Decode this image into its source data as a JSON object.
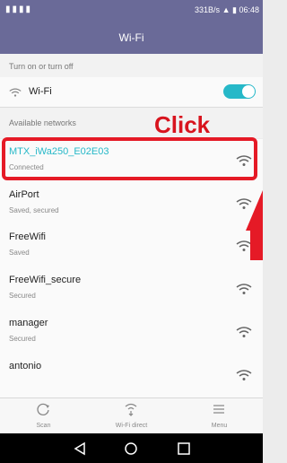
{
  "status": {
    "icons_left": "▮▮▮▮",
    "net_speed": "331B/s",
    "time": "06:48"
  },
  "titlebar": {
    "title": "Wi-Fi"
  },
  "sections": {
    "toggle_header": "Turn on or turn off",
    "available_header": "Available networks"
  },
  "wifi_toggle": {
    "label": "Wi-Fi",
    "state": "on"
  },
  "annotation": {
    "click_text": "Click",
    "highlight_color": "#e51a26"
  },
  "networks": [
    {
      "name": "MTX_iWa250_E02E03",
      "status": "Connected"
    },
    {
      "name": "AirPort",
      "status": "Saved, secured"
    },
    {
      "name": "FreeWifi",
      "status": "Saved"
    },
    {
      "name": "FreeWifi_secure",
      "status": "Secured"
    },
    {
      "name": "manager",
      "status": "Secured"
    },
    {
      "name": "antonio",
      "status": ""
    }
  ],
  "bottom_bar": {
    "scan": "Scan",
    "wifi_direct": "Wi-Fi direct",
    "menu": "Menu"
  },
  "colors": {
    "accent": "#26b8c8",
    "header": "#6a6a98",
    "annotation": "#d8141e"
  }
}
